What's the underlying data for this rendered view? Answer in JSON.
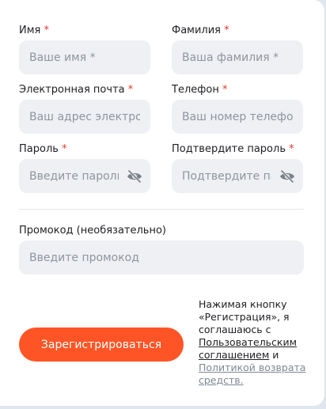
{
  "form": {
    "first_name": {
      "label": "Имя",
      "required": "*",
      "placeholder": "Ваше имя *"
    },
    "last_name": {
      "label": "Фамилия",
      "required": "*",
      "placeholder": "Ваша фамилия *"
    },
    "email": {
      "label": "Электронная почта",
      "required": "*",
      "placeholder": "Ваш адрес электронной почты *"
    },
    "phone": {
      "label": "Телефон",
      "required": "*",
      "placeholder": "Ваш номер телефона *"
    },
    "password": {
      "label": "Пароль",
      "required": "*",
      "placeholder": "Введите пароль"
    },
    "password_confirm": {
      "label": "Подтвердите пароль",
      "required": "*",
      "placeholder": "Подтвердите пароль"
    },
    "promo": {
      "label": "Промокод (необязательно)",
      "placeholder": "Введите промокод"
    },
    "submit_label": "Зарегистрироваться",
    "icons": {
      "password_toggle": "eye-off-icon"
    }
  },
  "consent": {
    "text_before": "Нажимая кнопку «Регистрация», я соглашаюсь с",
    "agreement_link": "Пользовательским соглашением",
    "text_and": "и",
    "refund_link": "Политикой возврата средств."
  },
  "colors": {
    "accent": "#ff5526",
    "required": "#e5382c",
    "input_bg": "#eef0f4",
    "muted_link": "#7f8893"
  }
}
